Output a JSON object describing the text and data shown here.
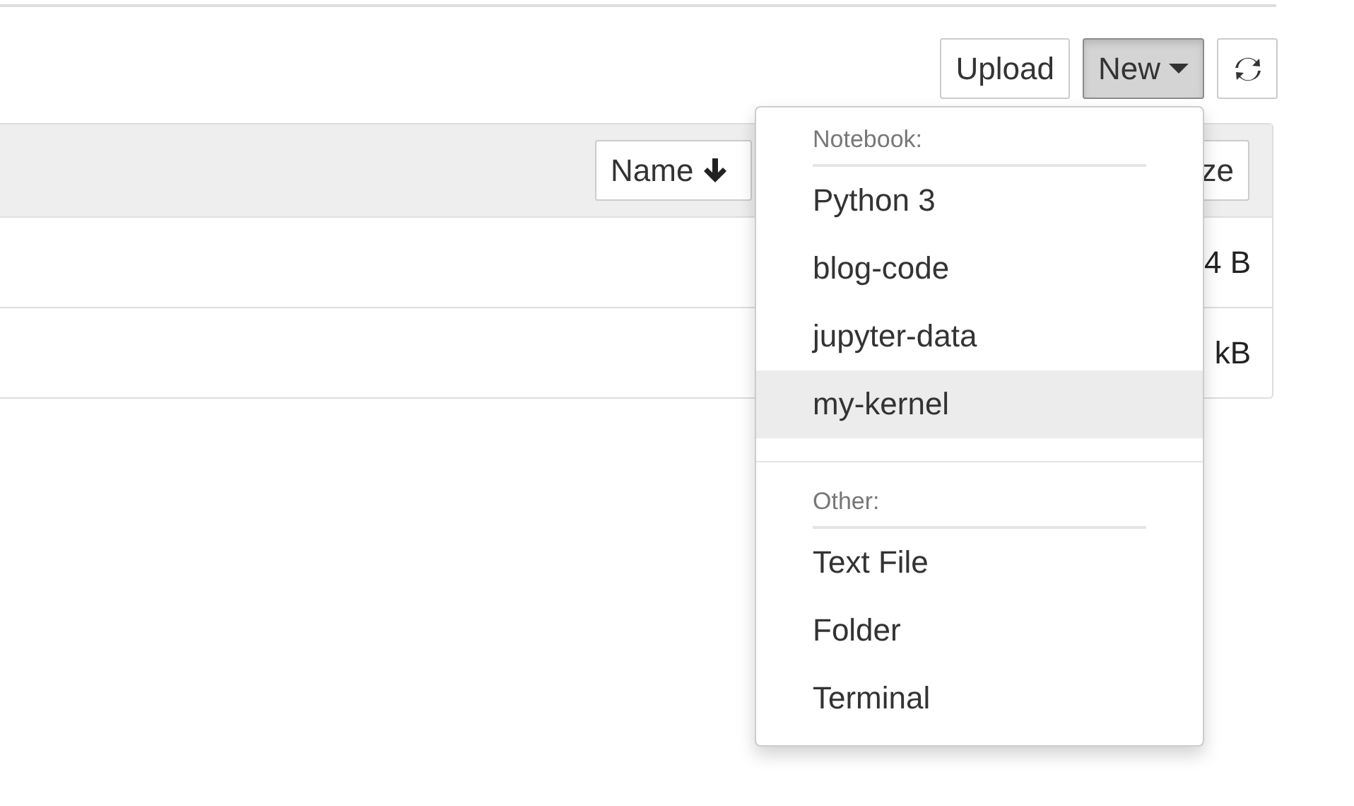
{
  "toolbar": {
    "buttons": [
      {
        "kind": "text",
        "label": "Upload",
        "active": false
      },
      {
        "kind": "dropdown",
        "label": "New",
        "active": true
      },
      {
        "kind": "refresh",
        "active": false
      }
    ]
  },
  "table": {
    "header": {
      "sort_button": "Name",
      "column_2": "ze"
    },
    "rows": [
      {
        "size": "4 B"
      },
      {
        "size": "kB"
      }
    ]
  },
  "menu": {
    "sections": [
      {
        "header": "Notebook:",
        "items": [
          {
            "label": "Python 3",
            "selected": false
          },
          {
            "label": "blog-code",
            "selected": false
          },
          {
            "label": "jupyter-data",
            "selected": false
          },
          {
            "label": "my-kernel",
            "selected": true
          }
        ]
      },
      {
        "header": "Other:",
        "items": [
          {
            "label": "Text File",
            "selected": false
          },
          {
            "label": "Folder",
            "selected": false
          },
          {
            "label": "Terminal",
            "selected": false
          }
        ]
      }
    ]
  }
}
